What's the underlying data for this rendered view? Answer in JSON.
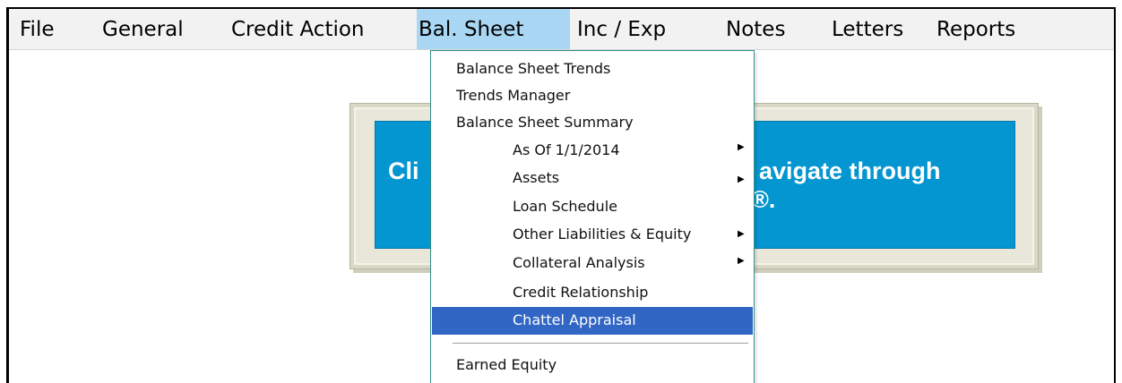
{
  "menubar": {
    "items": [
      {
        "label": "File"
      },
      {
        "label": "General"
      },
      {
        "label": "Credit Action"
      },
      {
        "label": "Bal. Sheet"
      },
      {
        "label": "Inc / Exp"
      },
      {
        "label": "Notes"
      },
      {
        "label": "Letters"
      },
      {
        "label": "Reports"
      }
    ]
  },
  "banner": {
    "text_left": "Cli",
    "text_right_line1": "avigate through",
    "text_right_line2": "®."
  },
  "dropdown": {
    "items": [
      {
        "label": "Balance Sheet Trends"
      },
      {
        "label": "Trends Manager"
      },
      {
        "label": "Balance Sheet Summary"
      },
      {
        "label": "As Of 1/1/2014"
      },
      {
        "label": "Assets"
      },
      {
        "label": "Loan Schedule"
      },
      {
        "label": "Other Liabilities & Equity"
      },
      {
        "label": "Collateral Analysis"
      },
      {
        "label": "Credit Relationship"
      },
      {
        "label": "Chattel Appraisal"
      },
      {
        "label": "Earned Equity"
      }
    ],
    "highlighted": "Chattel Appraisal"
  },
  "colors": {
    "menu_active": "#a9d6f2",
    "highlight": "#3166c4",
    "banner_blue": "#0396d0"
  }
}
